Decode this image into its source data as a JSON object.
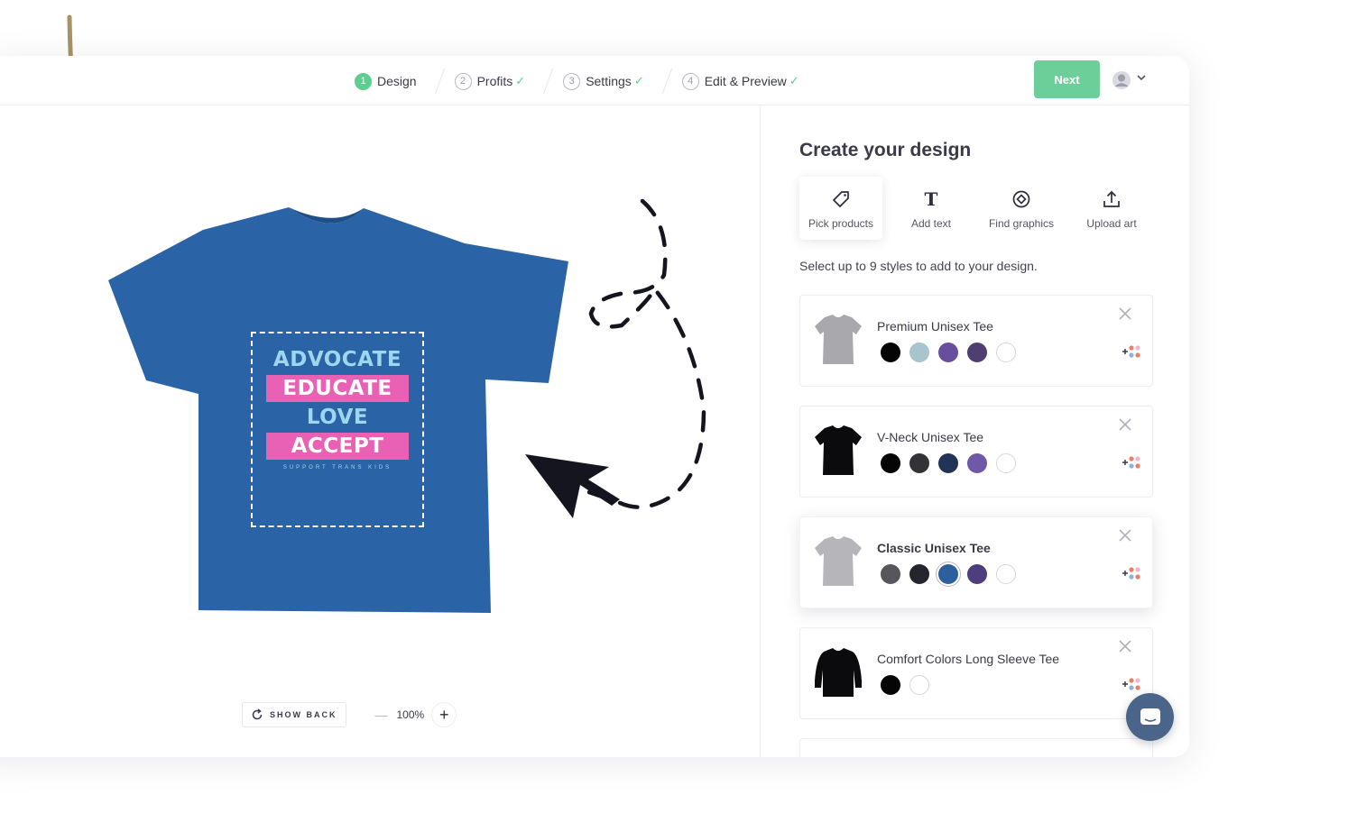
{
  "header": {
    "steps": [
      {
        "num": "1",
        "label": "Design",
        "active": true,
        "done": false
      },
      {
        "num": "2",
        "label": "Profits",
        "active": false,
        "done": true
      },
      {
        "num": "3",
        "label": "Settings",
        "active": false,
        "done": true
      },
      {
        "num": "4",
        "label": "Edit & Preview",
        "active": false,
        "done": true
      }
    ],
    "check_glyph": "✓",
    "next_label": "Next"
  },
  "canvas": {
    "design_lines": [
      "ADVOCATE",
      "EDUCATE",
      "LOVE",
      "ACCEPT"
    ],
    "design_small": "SUPPORT TRANS KIDS",
    "shirt_color": "#2b64a6",
    "show_back_label": "SHOW BACK",
    "zoom_minus": "—",
    "zoom_value": "100%",
    "zoom_plus": "+"
  },
  "panel": {
    "title": "Create your design",
    "tools": [
      {
        "icon": "tag-icon",
        "label": "Pick products"
      },
      {
        "icon": "text-icon",
        "glyph": "T",
        "label": "Add text"
      },
      {
        "icon": "graphics-icon",
        "label": "Find graphics"
      },
      {
        "icon": "upload-icon",
        "label": "Upload art"
      }
    ],
    "helper_text": "Select up to 9 styles to add to your design.",
    "products": [
      {
        "name": "Premium Unisex Tee",
        "thumb_color": "#a9a9ad",
        "colors": [
          "#050505",
          "#a8c4cc",
          "#6a4e9e",
          "#4f3e72",
          "#ffffff"
        ],
        "selected": false
      },
      {
        "name": "V-Neck Unisex Tee",
        "thumb_color": "#0b0b0d",
        "colors": [
          "#050505",
          "#333335",
          "#223455",
          "#6f58a8",
          "#ffffff"
        ],
        "selected": false
      },
      {
        "name": "Classic Unisex Tee",
        "thumb_color": "#b6b6ba",
        "colors": [
          "#56565c",
          "#25252f",
          "#2d5e9e",
          "#4e3e7e",
          "#ffffff"
        ],
        "selected": true
      },
      {
        "name": "Comfort Colors Long Sleeve Tee",
        "thumb_color": "#0b0b0d",
        "colors": [
          "#050505",
          "#ffffff"
        ],
        "selected": false
      }
    ]
  },
  "colors": {
    "accent_green": "#6ccf9a",
    "design_pink": "#e961b5",
    "design_blue": "#9dd6ee",
    "chat_button": "#4a6589"
  }
}
